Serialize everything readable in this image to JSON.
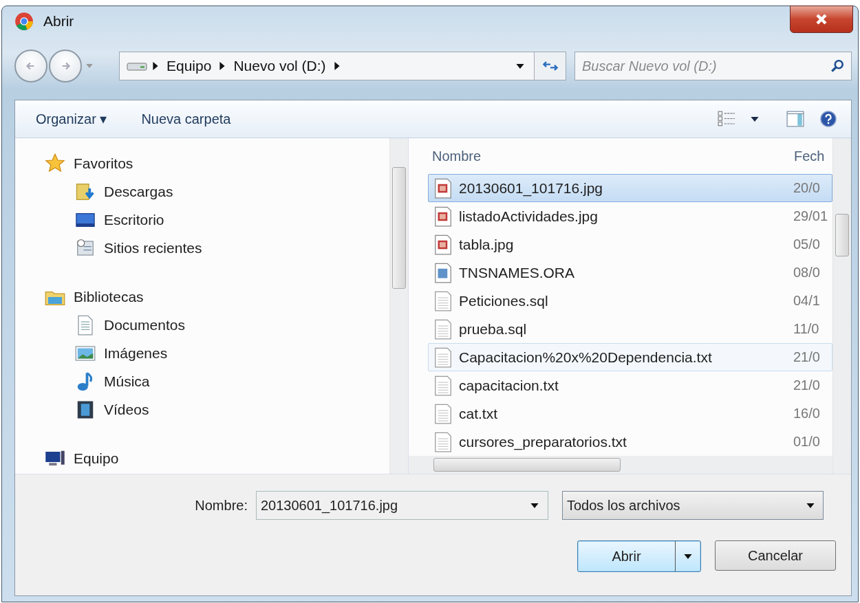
{
  "window": {
    "title": "Abrir"
  },
  "address": {
    "segments": [
      "Equipo",
      "Nuevo vol (D:)"
    ]
  },
  "search": {
    "placeholder": "Buscar Nuevo vol (D:)"
  },
  "toolbar": {
    "buttons": [
      "Organizar ▾",
      "Nueva carpeta"
    ]
  },
  "nav_pane": {
    "groups": [
      {
        "label": "Favoritos",
        "kind": "star",
        "children": [
          {
            "label": "Descargas",
            "kind": "downloads"
          },
          {
            "label": "Escritorio",
            "kind": "desktop"
          },
          {
            "label": "Sitios recientes",
            "kind": "recent"
          }
        ]
      },
      {
        "label": "Bibliotecas",
        "kind": "library",
        "children": [
          {
            "label": "Documentos",
            "kind": "document"
          },
          {
            "label": "Imágenes",
            "kind": "pictures"
          },
          {
            "label": "Música",
            "kind": "music"
          },
          {
            "label": "Vídeos",
            "kind": "video"
          }
        ]
      },
      {
        "label": "Equipo",
        "kind": "computer"
      }
    ]
  },
  "file_list": {
    "columns": [
      "Nombre",
      "Fech"
    ],
    "rows": [
      {
        "name": "20130601_101716.jpg",
        "date": "20/0",
        "kind": "image",
        "selected": true,
        "hovered": false
      },
      {
        "name": "listadoActividades.jpg",
        "date": "29/01",
        "kind": "image",
        "selected": false,
        "hovered": false
      },
      {
        "name": "tabla.jpg",
        "date": "05/0",
        "kind": "image",
        "selected": false,
        "hovered": false
      },
      {
        "name": "TNSNAMES.ORA",
        "date": "08/0",
        "kind": "config",
        "selected": false,
        "hovered": false
      },
      {
        "name": "Peticiones.sql",
        "date": "04/1",
        "kind": "text",
        "selected": false,
        "hovered": false
      },
      {
        "name": "prueba.sql",
        "date": "11/0",
        "kind": "text",
        "selected": false,
        "hovered": false
      },
      {
        "name": "Capacitacion%20x%20Dependencia.txt",
        "date": "21/0",
        "kind": "text",
        "selected": false,
        "hovered": true
      },
      {
        "name": "capacitacion.txt",
        "date": "21/0",
        "kind": "text",
        "selected": false,
        "hovered": false
      },
      {
        "name": "cat.txt",
        "date": "16/0",
        "kind": "text",
        "selected": false,
        "hovered": false
      },
      {
        "name": "cursores_preparatorios.txt",
        "date": "01/0",
        "kind": "text",
        "selected": false,
        "hovered": false
      }
    ]
  },
  "footer": {
    "name_label": "Nombre:",
    "name_value": "20130601_101716.jpg",
    "file_type": "Todos los archivos",
    "open_button": "Abrir",
    "cancel_button": "Cancelar"
  }
}
